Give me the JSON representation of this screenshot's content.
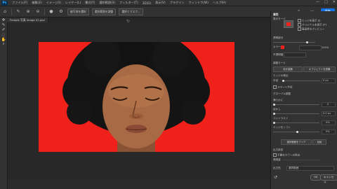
{
  "app": {
    "logo": "Ps"
  },
  "menu": [
    "ファイル(F)",
    "編集(E)",
    "イメージ(I)",
    "レイヤー(L)",
    "書式(Y)",
    "選択範囲(S)",
    "フィルター(T)",
    "3D(D)",
    "表示(V)",
    "プラグイン",
    "ウィンドウ(W)",
    "ヘルプ(H)"
  ],
  "window_controls": {
    "minimize": "—",
    "maximize": "□",
    "close": "✕"
  },
  "options": {
    "btn1": "被写体を選択",
    "btn2": "選択範囲を調整",
    "btn3": "選択とマスク...",
    "share": "共有"
  },
  "document": {
    "tab": "Freepik 写真 image 01.psd"
  },
  "panel": {
    "title": "属性",
    "view_mode": "表示モード",
    "show_edges": "エッジを表示 (J)",
    "show_original": "オリジナルを表示 (P)",
    "realtime": "高品質なプレビュー",
    "transparency": "透明部分",
    "opacity_label": "不透明度",
    "opacity_value": "100%",
    "color_label": "カラー",
    "refine_mode": "調整モード",
    "mode_color": "色を認識",
    "mode_object": "オブジェクトを認識",
    "edge_detect": "エッジの検出",
    "radius_label": "半径",
    "radius_value": "0 px",
    "smart_radius": "スマート半径",
    "global": "グローバル調整",
    "smooth_label": "滑らかに",
    "smooth_value": "0",
    "feather_label": "ぼかし",
    "feather_value": "0.0 px",
    "contrast_label": "コントラスト",
    "contrast_value": "0%",
    "shift_label": "エッジをシフト",
    "shift_value": "0%",
    "clear_selection": "選択範囲をクリア",
    "invert": "反転",
    "output": "出力設定",
    "decontaminate": "不要なカラーの除去",
    "amount": "適用量",
    "output_to": "出力先",
    "output_value": "選択範囲",
    "ok": "OK",
    "cancel": "キャンセル"
  },
  "colors": {
    "accent": "#1473e6",
    "canvas_bg": "#f0201a",
    "ui_dark": "#323232"
  }
}
